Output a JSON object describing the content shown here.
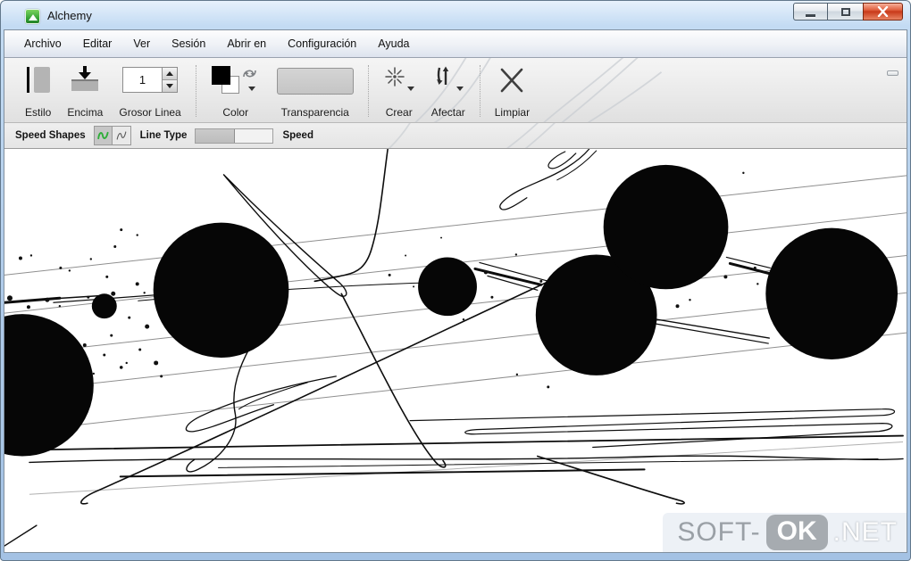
{
  "window": {
    "title": "Alchemy"
  },
  "menubar": {
    "items": [
      "Archivo",
      "Editar",
      "Ver",
      "Sesión",
      "Abrir en",
      "Configuración",
      "Ayuda"
    ]
  },
  "toolbar": {
    "estilo": "Estilo",
    "encima": "Encima",
    "grosor": "Grosor Linea",
    "grosor_value": "1",
    "color": "Color",
    "transparencia": "Transparencia",
    "crear": "Crear",
    "afectar": "Afectar",
    "limpiar": "Limpiar"
  },
  "subtoolbar": {
    "module": "Speed Shapes",
    "line_type": "Line Type",
    "speed": "Speed"
  },
  "watermark": {
    "prefix": "SOFT-",
    "ok": "OK",
    "suffix": ".NET"
  },
  "colors": {
    "title_blue": "#b7d3ee",
    "close_red": "#d0401f",
    "toggle_green": "#2fae39",
    "ink": "#0d0d0d"
  }
}
